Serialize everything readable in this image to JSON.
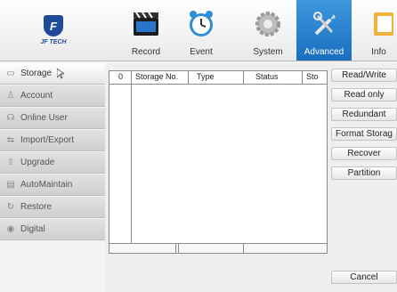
{
  "logo": {
    "brand": "JF TECH"
  },
  "nav": [
    {
      "label": "Record"
    },
    {
      "label": "Event"
    },
    {
      "label": "System"
    },
    {
      "label": "Advanced"
    },
    {
      "label": "Info"
    }
  ],
  "sidebar": {
    "items": [
      {
        "label": "Storage"
      },
      {
        "label": "Account"
      },
      {
        "label": "Online User"
      },
      {
        "label": "Import/Export"
      },
      {
        "label": "Upgrade"
      },
      {
        "label": "AutoMaintain"
      },
      {
        "label": "Restore"
      },
      {
        "label": "Digital"
      }
    ]
  },
  "table": {
    "columns": [
      "0",
      "Storage No.",
      "Type",
      "Status",
      "Sto"
    ]
  },
  "actions": {
    "read_write": "Read/Write",
    "read_only": "Read only",
    "redundant": "Redundant",
    "format": "Format Storag",
    "recover": "Recover",
    "partition": "Partition",
    "cancel": "Cancel"
  },
  "colors": {
    "accent": "#1a6fbf",
    "logo": "#1f4a9a"
  }
}
